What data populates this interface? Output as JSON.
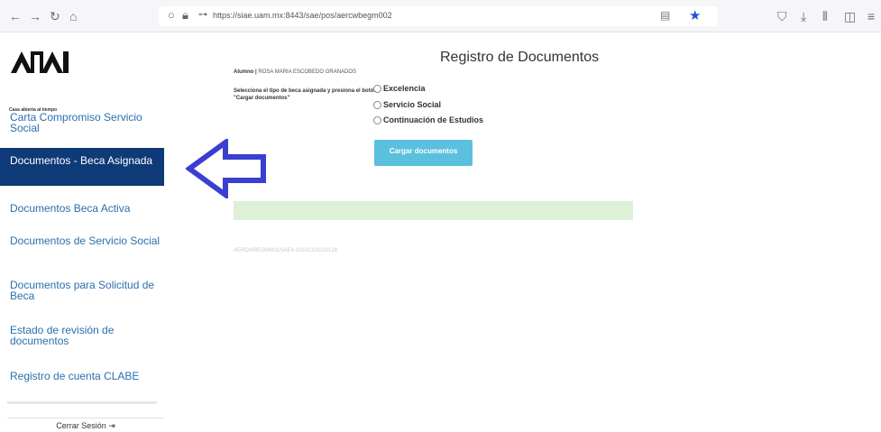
{
  "browser": {
    "url": "https://siae.uam.mx:8443/sae/pos/aercwbegm002",
    "icons": [
      "back-icon",
      "forward-icon",
      "reload-icon",
      "home-icon",
      "shield-icon",
      "lock-icon",
      "key-icon",
      "reader-icon",
      "star-icon",
      "pocket-icon",
      "download-icon",
      "library-icon",
      "sidebar-icon",
      "menu-icon"
    ]
  },
  "sidebar": {
    "logo_caption": "Casa abierta al tiempo",
    "items": [
      {
        "label": "Carta Compromiso Servicio Social"
      },
      {
        "label": "Documentos - Beca Asignada"
      },
      {
        "label": "Documentos Beca Activa"
      },
      {
        "label": "Documentos de Servicio Social"
      },
      {
        "label": "Documentos para Solicitud de Beca"
      },
      {
        "label": "Estado de revisión de documentos"
      },
      {
        "label": "Registro de cuenta CLABE"
      }
    ],
    "logout_label": "Cerrar Sesión"
  },
  "main": {
    "title": "Registro de Documentos",
    "student_label": "Alumno |",
    "student_name": "ROSA MARIA ESCOBEDO GRANADOS",
    "prompt": "Selecciona el tipo de beca asignada y presiona el botón \"Cargar documentos\"",
    "options": [
      {
        "label": "Excelencia"
      },
      {
        "label": "Servicio Social"
      },
      {
        "label": "Continuación de Estudios"
      }
    ],
    "upload_button": "Cargar documentos",
    "footer_code": "AERCWBEGM001/SAE4.0/GACI20210128"
  },
  "colors": {
    "active_nav": "#0f3a78",
    "nav_link": "#2a6fae",
    "button": "#5bc0de",
    "alert_bar": "#dff0d8",
    "annotation_arrow": "#3a3fd1"
  }
}
